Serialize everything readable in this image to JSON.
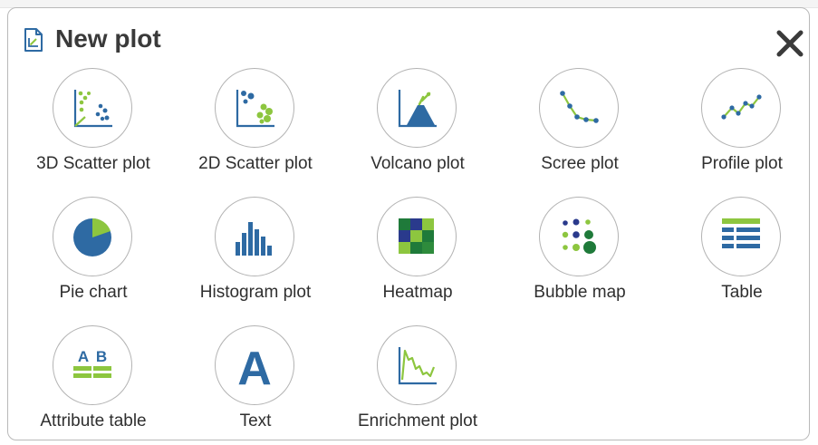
{
  "dialog": {
    "title": "New plot",
    "icons": {
      "header": "new-plot-icon",
      "close": "close-icon"
    },
    "colors": {
      "blue": "#2e6aa3",
      "green": "#8dc63f",
      "dark_green": "#1f7a3a",
      "navy": "#2a3a8c"
    }
  },
  "plot_types": [
    {
      "label": "3D Scatter plot",
      "icon": "3d-scatter-plot-icon"
    },
    {
      "label": "2D Scatter plot",
      "icon": "2d-scatter-plot-icon"
    },
    {
      "label": "Volcano plot",
      "icon": "volcano-plot-icon"
    },
    {
      "label": "Scree plot",
      "icon": "scree-plot-icon"
    },
    {
      "label": "Profile plot",
      "icon": "profile-plot-icon"
    },
    {
      "label": "Pie chart",
      "icon": "pie-chart-icon"
    },
    {
      "label": "Histogram plot",
      "icon": "histogram-plot-icon"
    },
    {
      "label": "Heatmap",
      "icon": "heatmap-icon"
    },
    {
      "label": "Bubble map",
      "icon": "bubble-map-icon"
    },
    {
      "label": "Table",
      "icon": "table-icon"
    },
    {
      "label": "Attribute table",
      "icon": "attribute-table-icon",
      "glyphs": [
        "A",
        "B"
      ]
    },
    {
      "label": "Text",
      "icon": "text-icon",
      "glyph": "A"
    },
    {
      "label": "Enrichment plot",
      "icon": "enrichment-plot-icon"
    }
  ]
}
